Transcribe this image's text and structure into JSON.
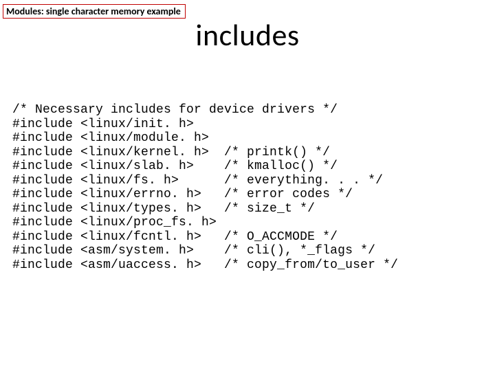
{
  "breadcrumb": "Modules: single character memory example",
  "title": "includes",
  "code_lines": [
    "/* Necessary includes for device drivers */",
    "#include <linux/init. h>",
    "#include <linux/module. h>",
    "#include <linux/kernel. h>  /* printk() */",
    "#include <linux/slab. h>    /* kmalloc() */",
    "#include <linux/fs. h>      /* everything. . . */",
    "#include <linux/errno. h>   /* error codes */",
    "#include <linux/types. h>   /* size_t */",
    "#include <linux/proc_fs. h>",
    "#include <linux/fcntl. h>   /* O_ACCMODE */",
    "#include <asm/system. h>    /* cli(), *_flags */",
    "#include <asm/uaccess. h>   /* copy_from/to_user */"
  ]
}
